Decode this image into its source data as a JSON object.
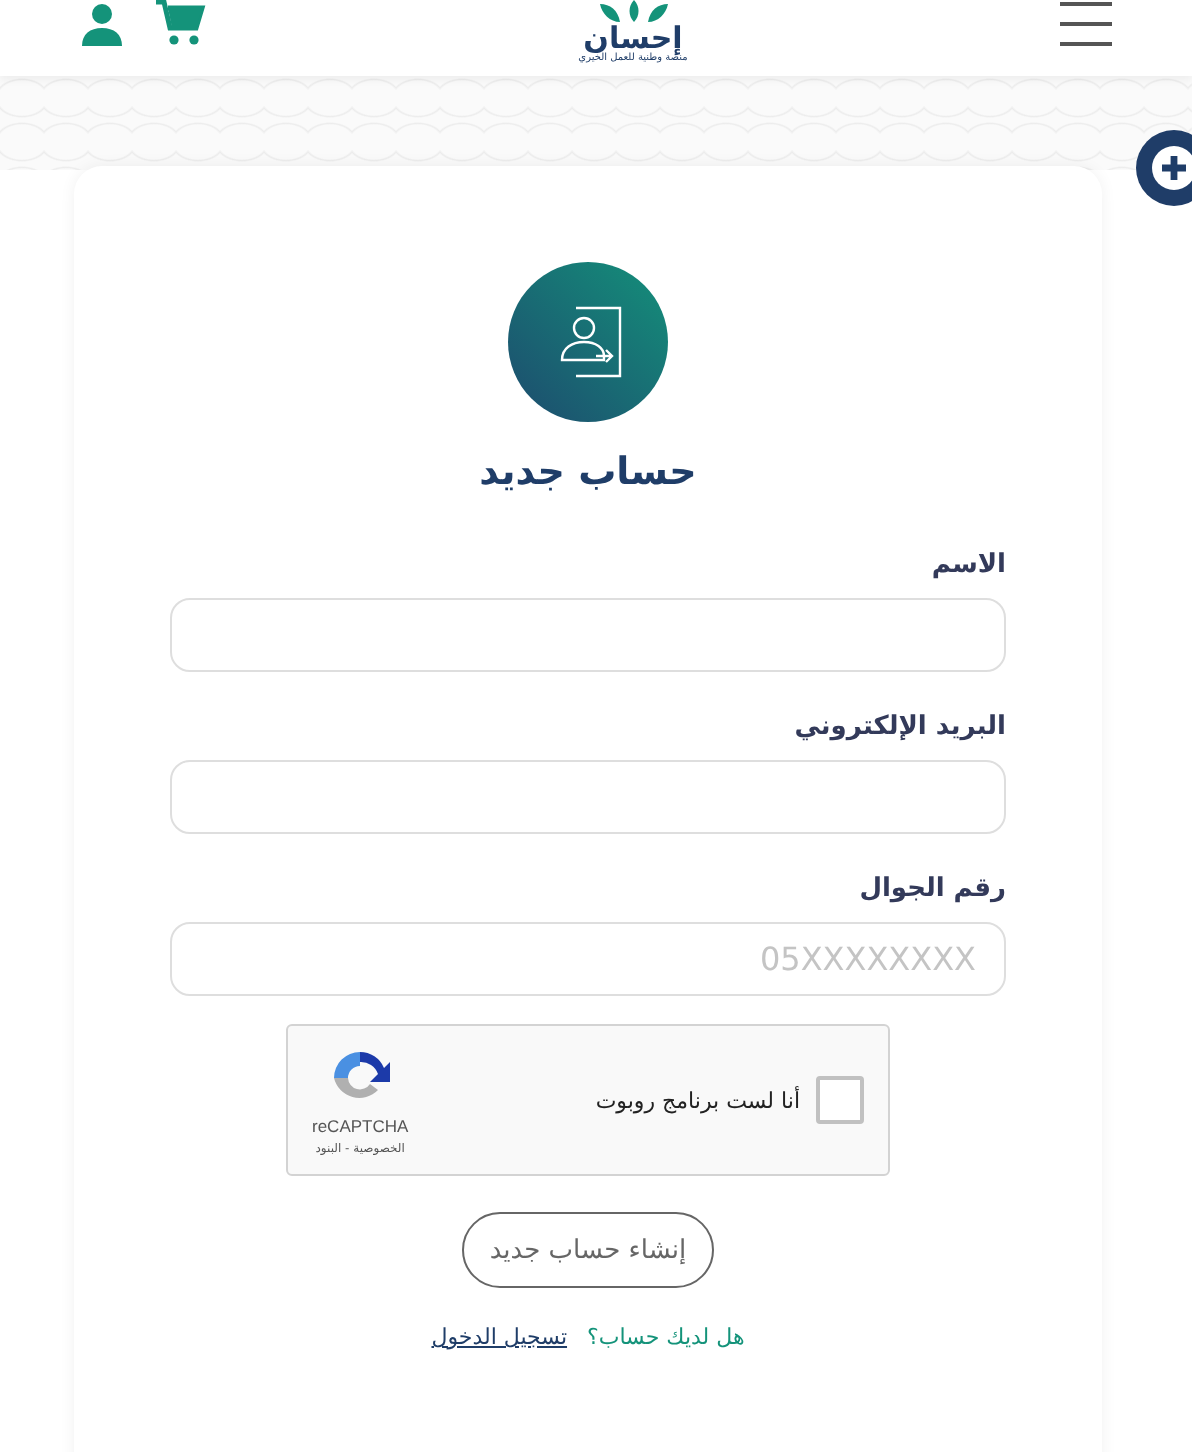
{
  "header": {
    "logo": {
      "name": "إحسان",
      "tagline": "منصة وطنية للعمل الخيري"
    }
  },
  "form": {
    "title": "حساب جديد",
    "fields": [
      {
        "label": "الاسم"
      },
      {
        "label": "البريد الإلكتروني"
      },
      {
        "label": "رقم الجوال",
        "placeholder": "05XXXXXXXX"
      }
    ],
    "captcha": {
      "label": "أنا لست برنامج روبوت",
      "checked": false,
      "brand": "reCAPTCHA",
      "links": "الخصوصية - البنود"
    },
    "submit": "إنشاء حساب جديد",
    "login_prompt": {
      "question": "هل لديك حساب؟",
      "link": "تسجيل الدخول"
    }
  }
}
